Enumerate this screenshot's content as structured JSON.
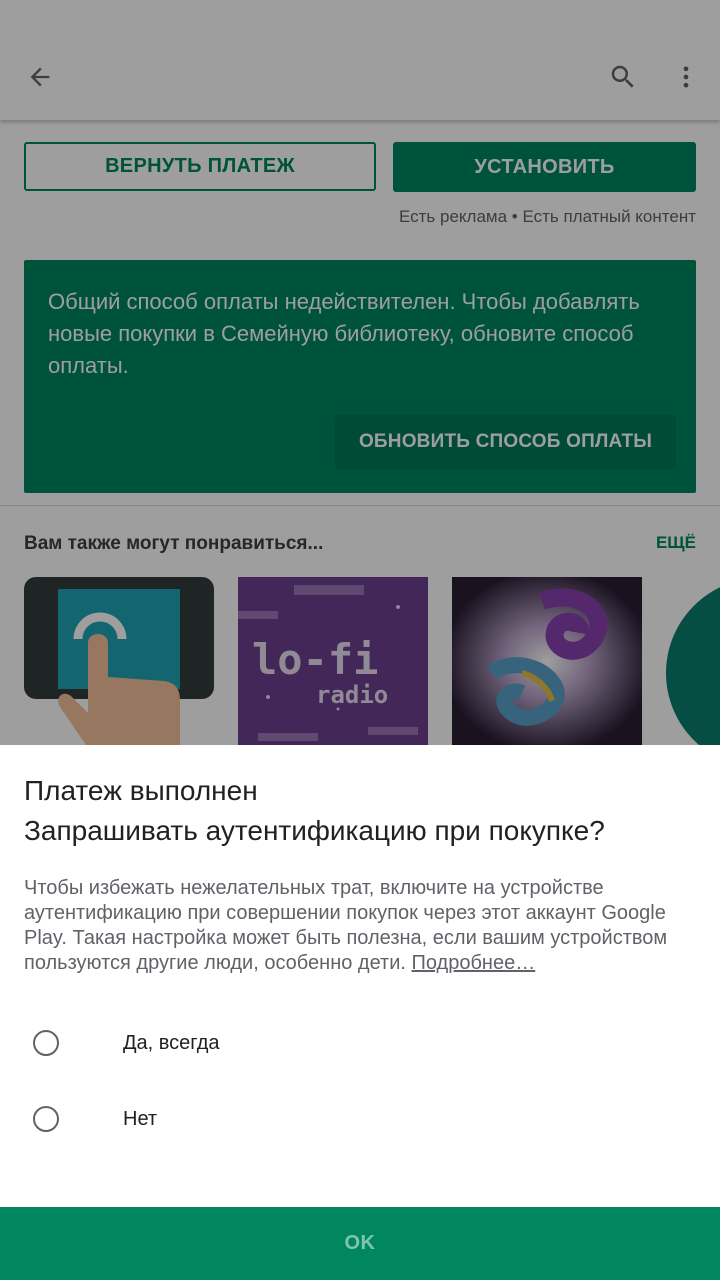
{
  "toolbar": {
    "back_icon": "arrow-back-icon",
    "search_icon": "search-icon",
    "more_icon": "more-vert-icon"
  },
  "actions": {
    "refund_label": "ВЕРНУТЬ ПЛАТЕЖ",
    "install_label": "УСТАНОВИТЬ",
    "ads_note": "Есть реклама • Есть платный контент"
  },
  "payment_warning": {
    "text": "Общий способ оплаты недействителен. Чтобы добавлять новые покупки в Семейную библиотеку, обновите способ оплаты.",
    "button_label": "ОБНОВИТЬ СПОСОБ ОПЛАТЫ"
  },
  "recommendations": {
    "title": "Вам также могут понравиться...",
    "more_label": "ЕЩЁ",
    "tiles": [
      {
        "icon": "touch-hand-icon"
      },
      {
        "line1": "lo-fi",
        "line2": "radio"
      },
      {
        "icon": "abstract-art-icon"
      },
      {
        "icon": "teal-circle-icon"
      }
    ]
  },
  "dialog": {
    "title_line1": "Платеж выполнен",
    "title_line2": "Запрашивать аутентификацию при покупке?",
    "body": "Чтобы избежать нежелательных трат, включите на устройстве аутентификацию при совершении покупок через этот аккаунт Google Play. Такая настройка может быть полезна, если вашим устройством пользуются другие люди, особенно дети. ",
    "link": "Подробнее…",
    "options": [
      {
        "label": "Да, всегда",
        "selected": false
      },
      {
        "label": "Нет",
        "selected": false
      }
    ],
    "ok_label": "OK"
  },
  "colors": {
    "accent": "#01875f",
    "scrim": "rgba(0,0,0,0.38)"
  }
}
